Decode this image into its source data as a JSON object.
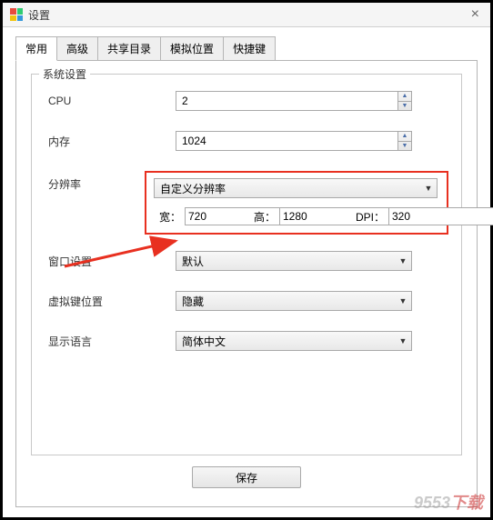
{
  "title": "设置",
  "close_glyph": "×",
  "tabs": [
    "常用",
    "高级",
    "共享目录",
    "模拟位置",
    "快捷键"
  ],
  "active_tab_index": 0,
  "fieldset_label": "系统设置",
  "cpu": {
    "label": "CPU",
    "value": "2"
  },
  "memory": {
    "label": "内存",
    "value": "1024"
  },
  "resolution": {
    "label": "分辨率",
    "mode": "自定义分辨率",
    "width_label": "宽：",
    "width": "720",
    "height_label": "高：",
    "height": "1280",
    "dpi_label": "DPI：",
    "dpi": "320"
  },
  "window_setting": {
    "label": "窗口设置",
    "value": "默认"
  },
  "virtual_key_pos": {
    "label": "虚拟键位置",
    "value": "隐藏"
  },
  "display_language": {
    "label": "显示语言",
    "value": "简体中文"
  },
  "save_button": "保存",
  "watermark": {
    "a": "9553",
    "b": "下载"
  }
}
